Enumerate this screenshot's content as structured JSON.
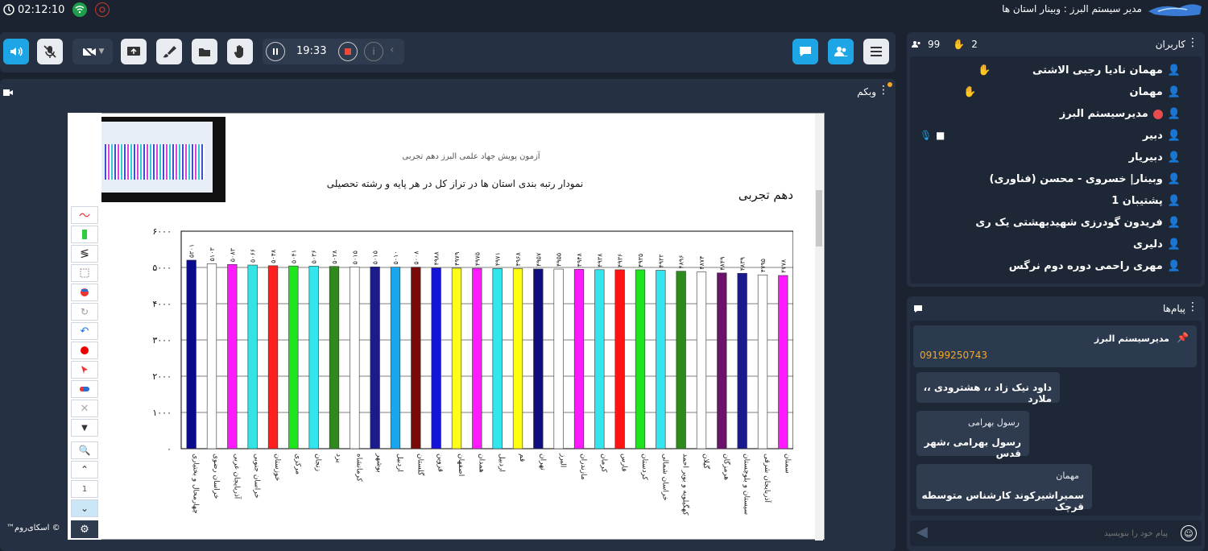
{
  "topbar": {
    "time": "02:12:10",
    "title": "مدیر سیستم البرز : وبینار استان ها"
  },
  "toolbar": {
    "timer": "19:33"
  },
  "webcam": {
    "title": "وبکم"
  },
  "brand": {
    "label": "™اسکای‌روم ©"
  },
  "tools": {
    "page_number": "1"
  },
  "users": {
    "title": "کاربران",
    "count": "99",
    "hand_count": "2",
    "list": [
      "مهمان نادیا رجبی الاشتی",
      "مهمان",
      "مدیرسیستم البرز",
      "دبیر",
      "دبیریار",
      "وبینار| خسروی - محسن (فناوری)",
      "پشتیبان 1",
      "فریدون گودرزی شهیدبهشتی یک ری",
      "دلیری",
      "مهری راحمی دوره دوم نرگس"
    ]
  },
  "messages": {
    "title": "پیام‌ها",
    "pinned_sender": "مدیرسیستم البرز",
    "pinned_text": "09199250743",
    "items": [
      {
        "text": "داود نیک زاد ،، هشترودی ،، ملارد"
      },
      {
        "sender": "رسول بهرامی",
        "text": "رسول بهرامی ،شهر قدس"
      },
      {
        "sender": "مهمان",
        "text": "سمیراشیرکوند کارشناس متوسطه قرچک"
      }
    ],
    "input_placeholder": "پیام خود را بنویسید"
  },
  "slide": {
    "header": "آزمون پویش جهاد علمی البرز دهم تجربی",
    "title": "نمودار رتبه بندی استان ها در تراز کل  در هر پایه و رشته تحصیلی",
    "subtitle": "دهم تجربی"
  },
  "chart_data": {
    "type": "bar",
    "ylim": [
      0,
      6000
    ],
    "yticks": [
      "۶۰۰۰",
      "۵۰۰۰",
      "۴۰۰۰",
      "۳۰۰۰",
      "۲۰۰۰",
      "۱۰۰۰",
      "۰"
    ],
    "categories": [
      "چهارمحال و بختیاری",
      "خراسان رضوی",
      "آذربایجان غربی",
      "خراسان جنوبی",
      "خوزستان",
      "مرکزی",
      "زنجان",
      "یزد",
      "کرمانشاه",
      "بوشهر",
      "اردبیل",
      "گلستان",
      "قزوین",
      "اصفهان",
      "همدان",
      "اردبیل",
      "قم",
      "تهران",
      "البرز",
      "مازندران",
      "کرمان",
      "فارس",
      "کردستان",
      "خراسان شمالی",
      "کهگیلویه و بویر احمد",
      "گیلان",
      "هرمزگان",
      "سیستان و بلوچستان",
      "آذربایجان شرقی",
      "سمنان"
    ],
    "values": [
      5201,
      5103,
      5083,
      5066,
      5048,
      5041,
      5036,
      5028,
      5015,
      5015,
      5010,
      5008,
      4988,
      4979,
      4975,
      4971,
      4968,
      4957,
      4955,
      4948,
      4938,
      4936,
      4935,
      4922,
      4896,
      4874,
      4849,
      4839,
      4795,
      4778
    ],
    "labels": [
      "۵۲۰۱",
      "۵۱۰۳",
      "۵۰۸۳",
      "۵۰۶۶",
      "۵۰۴۸",
      "۵۰۴۱",
      "۵۰۳۶",
      "۵۰۲۸",
      "۵۰۱۵",
      "۵۰۱۵",
      "۵۰۱۰",
      "۵۰۰۸",
      "۴۹۸۸",
      "۴۹۷۹",
      "۴۹۷۵",
      "۴۹۷۱",
      "۴۹۶۸",
      "۴۹۵۷",
      "۴۹۵۵",
      "۴۹۴۸",
      "۴۹۳۸",
      "۴۹۳۶",
      "۴۹۳۵",
      "۴۹۲۲",
      "۴۸۹۶",
      "۴۸۷۴",
      "۴۸۴۹",
      "۴۸۳۹",
      "۴۷۹۵",
      "۴۷۷۸"
    ],
    "colors": [
      "#0a0a8c",
      "#ffffff",
      "#ff19ff",
      "#34e3e3",
      "#ff1f1f",
      "#1ee61e",
      "#33e6ee",
      "#2e8a1c",
      "#ffffff",
      "#1b1b8a",
      "#19a6ee",
      "#7a0a0a",
      "#1414d8",
      "#ffff1a",
      "#ff1aff",
      "#33e6ee",
      "#ffff10",
      "#0e0e80",
      "#ffffff",
      "#ff19ff",
      "#33e6ee",
      "#ff1414",
      "#1ee61e",
      "#33e6ee",
      "#2e8a1c",
      "#ffffff",
      "#6c116c",
      "#1a1a8a",
      "#ffffff",
      "#ff19ff"
    ],
    "grid": true
  }
}
